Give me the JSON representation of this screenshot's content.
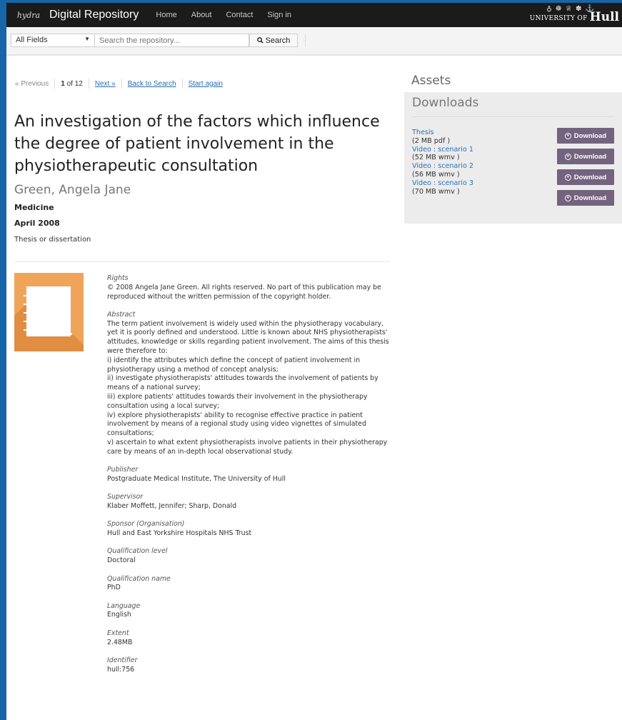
{
  "nav": {
    "brand": "Digital Repository",
    "logo_text": "hydra",
    "links": [
      "Home",
      "About",
      "Contact",
      "Sign in"
    ],
    "university_crest": "♁ ☸ ♕ ✽ ⚓",
    "university_prefix": "UNIVERSITY OF",
    "university_name": "Hull"
  },
  "search": {
    "field_selected": "All Fields",
    "placeholder": "Search the repository...",
    "button_label": "Search"
  },
  "pagination": {
    "previous": "« Previous",
    "position": "1",
    "total": "of 12",
    "next": "Next »",
    "back": "Back to Search",
    "restart": "Start again"
  },
  "record": {
    "title": "An investigation of the factors which influence the degree of patient involvement in the physiotherapeutic consultation",
    "author": "Green, Angela Jane",
    "department": "Medicine",
    "date": "April 2008",
    "type": "Thesis or dissertation",
    "metadata": [
      {
        "label": "Rights",
        "value": "© 2008 Angela Jane Green. All rights reserved. No part of this publication may be reproduced without the written permission of the copyright holder."
      },
      {
        "label": "Abstract",
        "value": "The term patient involvement is widely used within the physiotherapy vocabulary, yet it is poorly defined and understood. Little is known about NHS physiotherapists' attitudes, knowledge or skills regarding patient involvement. The aims of this thesis were therefore to:\ni) identify the attributes which define the concept of patient involvement in physiotherapy using a method of concept analysis;\nii) investigate physiotherapists' attitudes towards the involvement of patients by means of a national survey;\niii) explore patients' attitudes towards their involvement in the physiotherapy consultation using a local survey;\niv) explore physiotherapists' ability to recognise effective practice in patient involvement by means of a regional study using video vignettes of simulated consultations;\nv) ascertain to what extent physiotherapists involve patients in their physiotherapy care by means of an in-depth local observational study."
      },
      {
        "label": "Publisher",
        "value": "Postgraduate Medical Institute, The University of Hull"
      },
      {
        "label": "Supervisor",
        "value": "Klaber Moffett, Jennifer; Sharp, Donald"
      },
      {
        "label": "Sponsor (Organisation)",
        "value": "Hull and East Yorkshire Hospitals NHS Trust"
      },
      {
        "label": "Qualification level",
        "value": "Doctoral"
      },
      {
        "label": "Qualification name",
        "value": "PhD"
      },
      {
        "label": "Language",
        "value": "English"
      },
      {
        "label": "Extent",
        "value": "2.48MB"
      },
      {
        "label": "Identifier",
        "value": "hull:756"
      }
    ]
  },
  "assets": {
    "heading": "Assets",
    "downloads_heading": "Downloads",
    "download_label": "Download",
    "files": [
      {
        "name": "Thesis",
        "size": "(2 MB pdf )"
      },
      {
        "name": "Video : scenario 1",
        "size": "(52 MB wmv )"
      },
      {
        "name": "Video : scenario 2",
        "size": "(56 MB wmv )"
      },
      {
        "name": "Video : scenario 3",
        "size": "(70 MB wmv )"
      }
    ]
  },
  "colors": {
    "navbar": "#1b1b1b",
    "frame_blue": "#1565a8",
    "link": "#2a72b5",
    "download_button": "#74637e",
    "thumbnail": "#f0a45a"
  }
}
